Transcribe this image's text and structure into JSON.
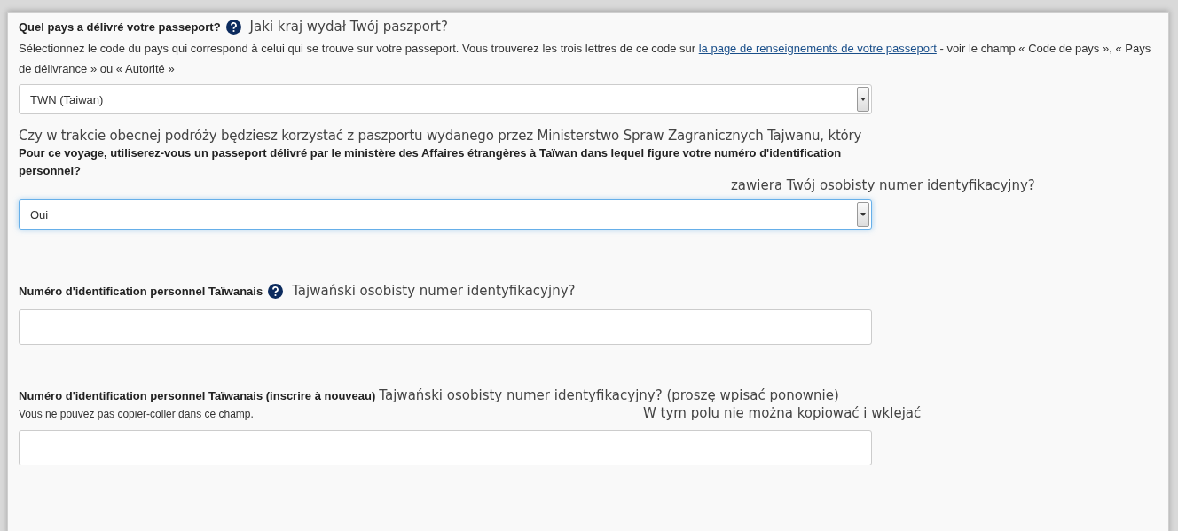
{
  "fields": [
    {
      "kind": "select",
      "label": "Quel pays a délivré votre passeport?",
      "help": true,
      "translation": "Jaki kraj wydał Twój paszport?",
      "hint_before": "Sélectionnez le code du pays qui correspond à celui qui se trouve sur votre passeport. Vous trouverez les trois lettres de ce code sur ",
      "hint_link": "la page de renseignements de votre passeport",
      "hint_after": " - voir le champ « Code de pays », « Pays de délivrance » ou « Autorité »",
      "value": "TWN (Taiwan)",
      "focused": false
    },
    {
      "kind": "select",
      "translation_before": "Czy w trakcie obecnej podróży będziesz korzystać z paszportu wydanego przez Ministerstwo Spraw Zagranicznych Tajwanu, który",
      "label": "Pour ce voyage, utiliserez-vous un passeport délivré par le ministère des Affaires étrangères à Taïwan dans lequel figure votre numéro d'identification personnel?",
      "help": false,
      "translation": "zawiera Twój osobisty numer identyfikacyjny?",
      "value": "Oui",
      "focused": true
    },
    {
      "kind": "text",
      "label": "Numéro d'identification personnel Taïwanais",
      "help": true,
      "translation": "Tajwański osobisty numer identyfikacyjny?",
      "focused": false
    },
    {
      "kind": "text",
      "label": "Numéro d'identification personnel Taïwanais (inscrire à nouveau)",
      "help": false,
      "translation": "Tajwański osobisty numer identyfikacyjny? (proszę wpisać ponownie)",
      "hint": "Vous ne pouvez pas copier-coller dans ce champ.",
      "hint_translation": "W tym polu nie można kopiować i wklejać",
      "focused": false
    }
  ]
}
